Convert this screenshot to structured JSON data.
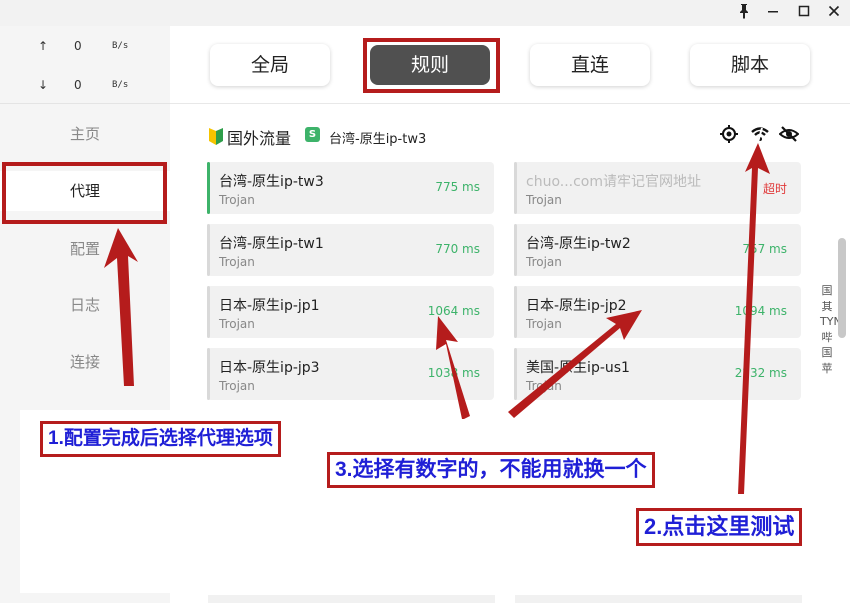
{
  "window": {
    "controls": [
      "pin-icon",
      "minimize-icon",
      "maximize-icon",
      "close-icon"
    ]
  },
  "traffic": {
    "up": {
      "arrow": "↑",
      "value": "0",
      "unit": "B/s"
    },
    "down": {
      "arrow": "↓",
      "value": "0",
      "unit": "B/s"
    }
  },
  "sidebar": {
    "items": [
      {
        "label": "主页"
      },
      {
        "label": "代理"
      },
      {
        "label": "配置"
      },
      {
        "label": "日志"
      },
      {
        "label": "连接"
      }
    ]
  },
  "tabs": [
    {
      "label": "全局"
    },
    {
      "label": "规则"
    },
    {
      "label": "直连"
    },
    {
      "label": "脚本"
    }
  ],
  "group": {
    "name": "国外流量",
    "badge": "S",
    "selected": "台湾-原生ip-tw3",
    "icons": [
      "locate-icon",
      "wifi-test-icon",
      "eye-hide-icon"
    ]
  },
  "proxies": [
    {
      "name": "台湾-原生ip-tw3",
      "type": "Trojan",
      "delay": "775 ms"
    },
    {
      "name": "chuo...com请牢记官网地址",
      "type": "Trojan",
      "delay": "超时"
    },
    {
      "name": "台湾-原生ip-tw1",
      "type": "Trojan",
      "delay": "770 ms"
    },
    {
      "name": "台湾-原生ip-tw2",
      "type": "Trojan",
      "delay": "757 ms"
    },
    {
      "name": "日本-原生ip-jp1",
      "type": "Trojan",
      "delay": "1064 ms"
    },
    {
      "name": "日本-原生ip-jp2",
      "type": "Trojan",
      "delay": "1094 ms"
    },
    {
      "name": "日本-原生ip-jp3",
      "type": "Trojan",
      "delay": "1038 ms"
    },
    {
      "name": "美国-原生ip-us1",
      "type": "Trojan",
      "delay": "2232 ms"
    }
  ],
  "vertical_text": "国其TYN哔国苹",
  "annotations": {
    "step1": "1.配置完成后选择代理选项",
    "step2": "2.点击这里测试",
    "step3": "3.选择有数字的，不能用就换一个"
  },
  "colors": {
    "accent_green": "#3db36a",
    "timeout_red": "#e03a3a",
    "annotation_red": "#b51c1c",
    "annotation_text_blue": "#1f1fd6",
    "active_tab": "#505050"
  }
}
